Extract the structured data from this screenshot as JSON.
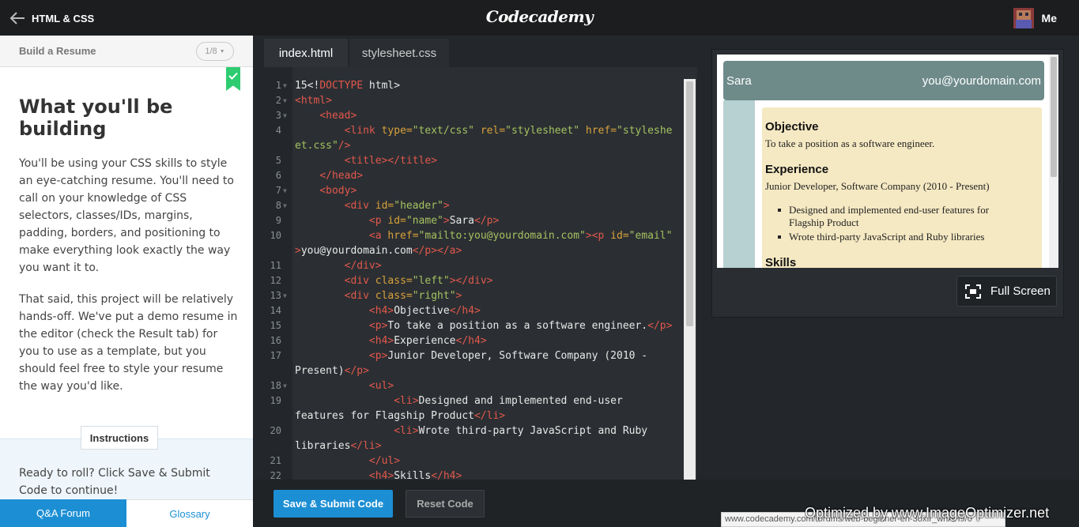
{
  "topbar": {
    "back_label": "HTML & CSS",
    "brand": "Codecademy",
    "user_label": "Me"
  },
  "lesson": {
    "title": "Build a Resume",
    "pager": "1/8",
    "heading": "What you'll be building",
    "para1": "You'll be using your CSS skills to style an eye-catching resume. You'll need to call on your knowledge of CSS selectors, classes/IDs, margins, padding, borders, and positioning to make everything look exactly the way you want it to.",
    "para2": "That said, this project will be relatively hands-off. We've put a demo resume in the editor (check the Result tab) for you to use as a template, but you should feel free to style your resume the way you'd like.",
    "instructions_tab": "Instructions",
    "instructions_text": "Ready to roll? Click Save & Submit Code to continue!",
    "qa_forum": "Q&A Forum",
    "glossary": "Glossary"
  },
  "editor": {
    "tabs": [
      "index.html",
      "stylesheet.css"
    ],
    "line_numbers": [
      "1",
      "2",
      "3",
      "4",
      "",
      "5",
      "6",
      "7",
      "8",
      "9",
      "10",
      "",
      "11",
      "12",
      "13",
      "14",
      "15",
      "16",
      "17",
      "",
      "18",
      "19",
      "",
      "20",
      "",
      "21",
      "22"
    ],
    "lines": [
      [
        {
          "t": "15<!",
          "c": ""
        },
        {
          "t": "DOCTYPE",
          "c": "tg"
        },
        {
          "t": " html>",
          "c": ""
        }
      ],
      [
        {
          "t": "<html>",
          "c": "tg"
        }
      ],
      [
        {
          "t": "    ",
          "c": ""
        },
        {
          "t": "<head>",
          "c": "tg"
        }
      ],
      [
        {
          "t": "        ",
          "c": ""
        },
        {
          "t": "<link ",
          "c": "tg"
        },
        {
          "t": "type=",
          "c": "at"
        },
        {
          "t": "\"text/css\"",
          "c": "st"
        },
        {
          "t": " rel=",
          "c": "at"
        },
        {
          "t": "\"stylesheet\"",
          "c": "st"
        },
        {
          "t": " href=",
          "c": "at"
        },
        {
          "t": "\"styleshe",
          "c": "st"
        }
      ],
      [
        {
          "t": "et.css\"",
          "c": "st"
        },
        {
          "t": "/>",
          "c": "tg"
        }
      ],
      [
        {
          "t": "        ",
          "c": ""
        },
        {
          "t": "<title></title>",
          "c": "tg"
        }
      ],
      [
        {
          "t": "    ",
          "c": ""
        },
        {
          "t": "</head>",
          "c": "tg"
        }
      ],
      [
        {
          "t": "    ",
          "c": ""
        },
        {
          "t": "<body>",
          "c": "tg"
        }
      ],
      [
        {
          "t": "        ",
          "c": ""
        },
        {
          "t": "<div ",
          "c": "tg"
        },
        {
          "t": "id=",
          "c": "at"
        },
        {
          "t": "\"header\"",
          "c": "st"
        },
        {
          "t": ">",
          "c": "tg"
        }
      ],
      [
        {
          "t": "            ",
          "c": ""
        },
        {
          "t": "<p ",
          "c": "tg"
        },
        {
          "t": "id=",
          "c": "at"
        },
        {
          "t": "\"name\"",
          "c": "st"
        },
        {
          "t": ">",
          "c": "tg"
        },
        {
          "t": "Sara",
          "c": ""
        },
        {
          "t": "</p>",
          "c": "tg"
        }
      ],
      [
        {
          "t": "            ",
          "c": ""
        },
        {
          "t": "<a ",
          "c": "tg"
        },
        {
          "t": "href=",
          "c": "at"
        },
        {
          "t": "\"mailto:you@yourdomain.com\"",
          "c": "st"
        },
        {
          "t": "><p ",
          "c": "tg"
        },
        {
          "t": "id=",
          "c": "at"
        },
        {
          "t": "\"email\"",
          "c": "st"
        }
      ],
      [
        {
          "t": ">",
          "c": "tg"
        },
        {
          "t": "you@yourdomain.com",
          "c": ""
        },
        {
          "t": "</p></a>",
          "c": "tg"
        }
      ],
      [
        {
          "t": "        ",
          "c": ""
        },
        {
          "t": "</div>",
          "c": "tg"
        }
      ],
      [
        {
          "t": "        ",
          "c": ""
        },
        {
          "t": "<div ",
          "c": "tg"
        },
        {
          "t": "class=",
          "c": "at"
        },
        {
          "t": "\"left\"",
          "c": "st"
        },
        {
          "t": "></div>",
          "c": "tg"
        }
      ],
      [
        {
          "t": "        ",
          "c": ""
        },
        {
          "t": "<div ",
          "c": "tg"
        },
        {
          "t": "class=",
          "c": "at"
        },
        {
          "t": "\"right\"",
          "c": "st"
        },
        {
          "t": ">",
          "c": "tg"
        }
      ],
      [
        {
          "t": "            ",
          "c": ""
        },
        {
          "t": "<h4>",
          "c": "tg"
        },
        {
          "t": "Objective",
          "c": ""
        },
        {
          "t": "</h4>",
          "c": "tg"
        }
      ],
      [
        {
          "t": "            ",
          "c": ""
        },
        {
          "t": "<p>",
          "c": "tg"
        },
        {
          "t": "To take a position as a software engineer.",
          "c": ""
        },
        {
          "t": "</p>",
          "c": "tg"
        }
      ],
      [
        {
          "t": "            ",
          "c": ""
        },
        {
          "t": "<h4>",
          "c": "tg"
        },
        {
          "t": "Experience",
          "c": ""
        },
        {
          "t": "</h4>",
          "c": "tg"
        }
      ],
      [
        {
          "t": "            ",
          "c": ""
        },
        {
          "t": "<p>",
          "c": "tg"
        },
        {
          "t": "Junior Developer, Software Company (2010 -",
          "c": ""
        }
      ],
      [
        {
          "t": "Present)",
          "c": ""
        },
        {
          "t": "</p>",
          "c": "tg"
        }
      ],
      [
        {
          "t": "            ",
          "c": ""
        },
        {
          "t": "<ul>",
          "c": "tg"
        }
      ],
      [
        {
          "t": "                ",
          "c": ""
        },
        {
          "t": "<li>",
          "c": "tg"
        },
        {
          "t": "Designed and implemented end-user",
          "c": ""
        }
      ],
      [
        {
          "t": "features for Flagship Product",
          "c": ""
        },
        {
          "t": "</li>",
          "c": "tg"
        }
      ],
      [
        {
          "t": "                ",
          "c": ""
        },
        {
          "t": "<li>",
          "c": "tg"
        },
        {
          "t": "Wrote third-party JavaScript and Ruby",
          "c": ""
        }
      ],
      [
        {
          "t": "libraries",
          "c": ""
        },
        {
          "t": "</li>",
          "c": "tg"
        }
      ],
      [
        {
          "t": "            ",
          "c": ""
        },
        {
          "t": "</ul>",
          "c": "tg"
        }
      ],
      [
        {
          "t": "            ",
          "c": ""
        },
        {
          "t": "<h4>",
          "c": "tg"
        },
        {
          "t": "Skills",
          "c": ""
        },
        {
          "t": "</h4>",
          "c": "tg"
        }
      ]
    ]
  },
  "result": {
    "name": "Sara",
    "email": "you@yourdomain.com",
    "objective_h": "Objective",
    "objective_p": "To take a position as a software engineer.",
    "experience_h": "Experience",
    "experience_p": "Junior Developer, Software Company (2010 - Present)",
    "li1": "Designed and implemented end-user features for Flagship Product",
    "li2": "Wrote third-party JavaScript and Ruby libraries",
    "skills_h": "Skills",
    "full_screen": "Full Screen"
  },
  "bottom": {
    "submit": "Save & Submit Code",
    "reset": "Reset Code",
    "status_url": "www.codecademy.com/forums/web-beginner-en-3oxIr_whAH9/0",
    "watermark": "Optimized by www.ImageOptimizer.net"
  },
  "colors": {
    "accent": "#1c8fd4",
    "tag": "#e2574c",
    "attr": "#d9a13b",
    "string": "#a5c261",
    "bookmark": "#2ecc71"
  },
  "icons": [
    "back-arrow-icon",
    "avatar",
    "chevron-down-icon",
    "check-icon",
    "fullscreen-icon",
    "fold-arrow-icon"
  ]
}
